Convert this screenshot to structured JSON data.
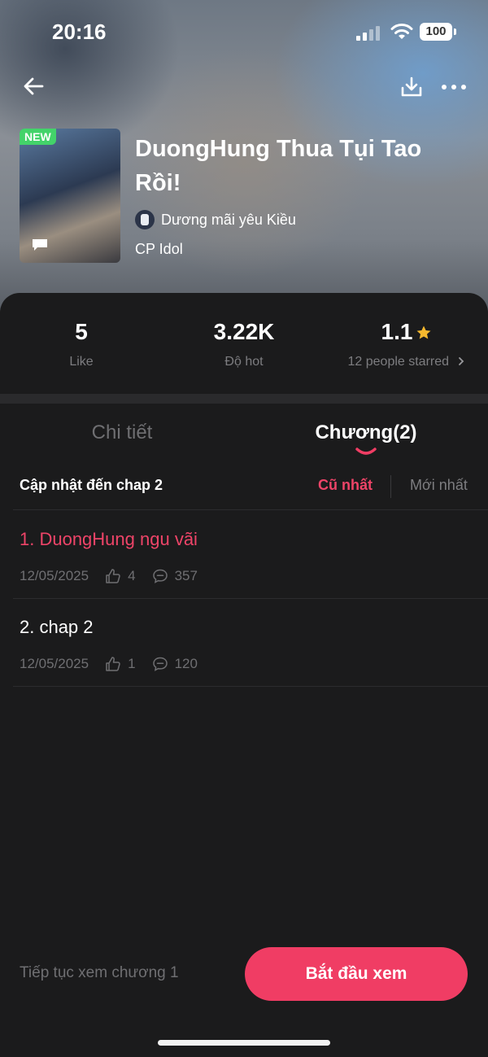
{
  "status_bar": {
    "time": "20:16",
    "battery": "100"
  },
  "book": {
    "badge": "NEW",
    "title": "DuongHung Thua Tụi Tao Rồi!",
    "author": "Dương mãi yêu Kiều",
    "category": "CP Idol"
  },
  "stats": {
    "likes": {
      "value": "5",
      "label": "Like"
    },
    "hot": {
      "value": "3.22K",
      "label": "Độ hot"
    },
    "rating": {
      "value": "1.1",
      "label": "12 people starred"
    }
  },
  "tabs": {
    "detail": "Chi tiết",
    "chapters": "Chương(2)"
  },
  "list_header": {
    "update_text": "Cập nhật đến chap 2",
    "sort_old": "Cũ nhất",
    "sort_new": "Mới nhất"
  },
  "chapters": [
    {
      "title": "1. DuongHung ngu vãi",
      "date": "12/05/2025",
      "likes": "4",
      "comments": "357",
      "active": true
    },
    {
      "title": "2. chap 2",
      "date": "12/05/2025",
      "likes": "1",
      "comments": "120",
      "active": false
    }
  ],
  "bottom": {
    "continue_text": "Tiếp tục xem chương 1",
    "start_button": "Bắt đầu xem"
  },
  "colors": {
    "accent": "#f03d64",
    "accent_text": "#ee4468",
    "star": "#f5b82e",
    "new_badge": "#43d36a",
    "background": "#1b1b1c"
  },
  "icons": [
    "back-arrow-icon",
    "download-icon",
    "more-icon",
    "chat-bubble-icon",
    "star-icon",
    "chevron-right-icon",
    "thumbs-up-icon",
    "comment-icon"
  ]
}
